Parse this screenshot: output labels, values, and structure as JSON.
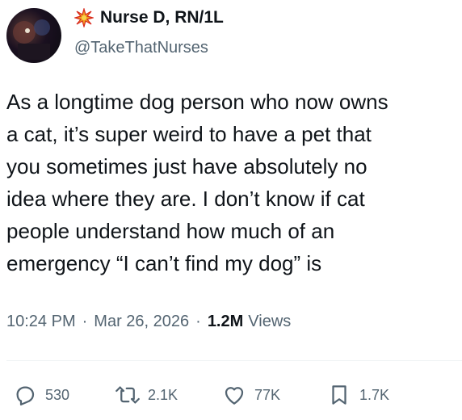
{
  "author": {
    "display_name": "Nurse D, RN/1L",
    "handle": "@TakeThatNurses",
    "avatar_icon": "profile-photo",
    "badge_icon": "burst-emoji-icon"
  },
  "tweet": {
    "text": "As a longtime dog person who now owns\na cat, it’s super weird to have a pet that\nyou sometimes just have absolutely no\nidea where they are. I don’t know if cat\npeople understand how much of an\nemergency “I can’t find my dog” is"
  },
  "meta": {
    "time": "10:24 PM",
    "separator": "·",
    "date": "Mar 26, 2026",
    "views_count": "1.2M",
    "views_label": "Views"
  },
  "actions": {
    "replies": "530",
    "reposts": "2.1K",
    "likes": "77K",
    "bookmarks": "1.7K"
  },
  "colors": {
    "text": "#0f1419",
    "secondary": "#536471",
    "divider": "#eff3f4"
  }
}
